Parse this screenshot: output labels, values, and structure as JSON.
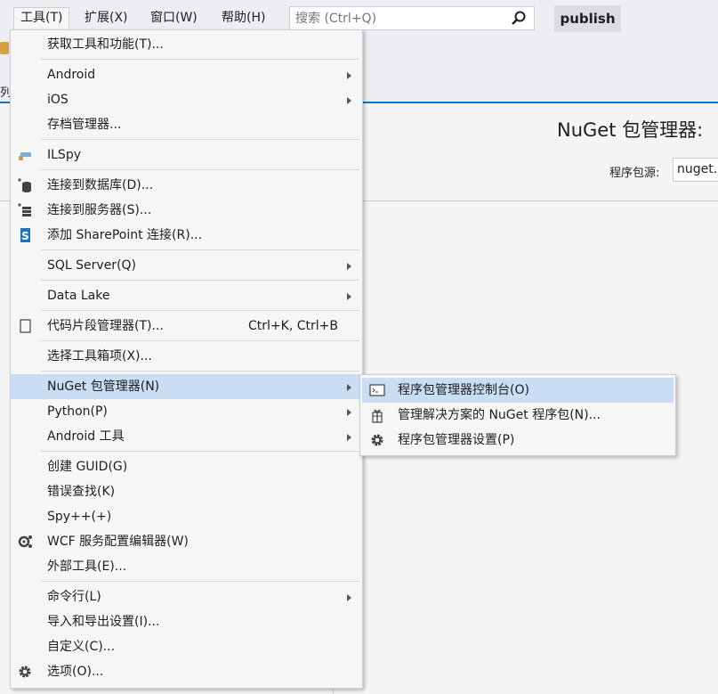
{
  "menubar": {
    "items": [
      "工具(T)",
      "扩展(X)",
      "窗口(W)",
      "帮助(H)"
    ],
    "search_placeholder": "搜索 (Ctrl+Q)",
    "publish_label": "publish"
  },
  "background": {
    "nuget_title": "NuGet 包管理器:",
    "source_label": "程序包源:",
    "source_value": "nuget.",
    "partial_tab": "列"
  },
  "menu": {
    "items": [
      {
        "label": "获取工具和功能(T)..."
      },
      {
        "label": "Android"
      },
      {
        "label": "iOS"
      },
      {
        "label": "存档管理器..."
      },
      {
        "label": "ILSpy"
      },
      {
        "label": "连接到数据库(D)..."
      },
      {
        "label": "连接到服务器(S)..."
      },
      {
        "label": "添加 SharePoint 连接(R)..."
      },
      {
        "label": "SQL Server(Q)"
      },
      {
        "label": "Data Lake"
      },
      {
        "label": "代码片段管理器(T)...",
        "shortcut": "Ctrl+K, Ctrl+B"
      },
      {
        "label": "选择工具箱项(X)..."
      },
      {
        "label": "NuGet 包管理器(N)"
      },
      {
        "label": "Python(P)"
      },
      {
        "label": "Android 工具"
      },
      {
        "label": "创建 GUID(G)"
      },
      {
        "label": "错误查找(K)"
      },
      {
        "label": "Spy++(+)"
      },
      {
        "label": "WCF 服务配置编辑器(W)"
      },
      {
        "label": "外部工具(E)..."
      },
      {
        "label": "命令行(L)"
      },
      {
        "label": "导入和导出设置(I)..."
      },
      {
        "label": "自定义(C)..."
      },
      {
        "label": "选项(O)..."
      }
    ]
  },
  "submenu": {
    "items": [
      {
        "label": "程序包管理器控制台(O)"
      },
      {
        "label": "管理解决方案的 NuGet 程序包(N)..."
      },
      {
        "label": "程序包管理器设置(P)"
      }
    ]
  },
  "colors": {
    "accent": "#007acc",
    "highlight": "#c9def5",
    "menu_bg": "#f6f6f6"
  }
}
